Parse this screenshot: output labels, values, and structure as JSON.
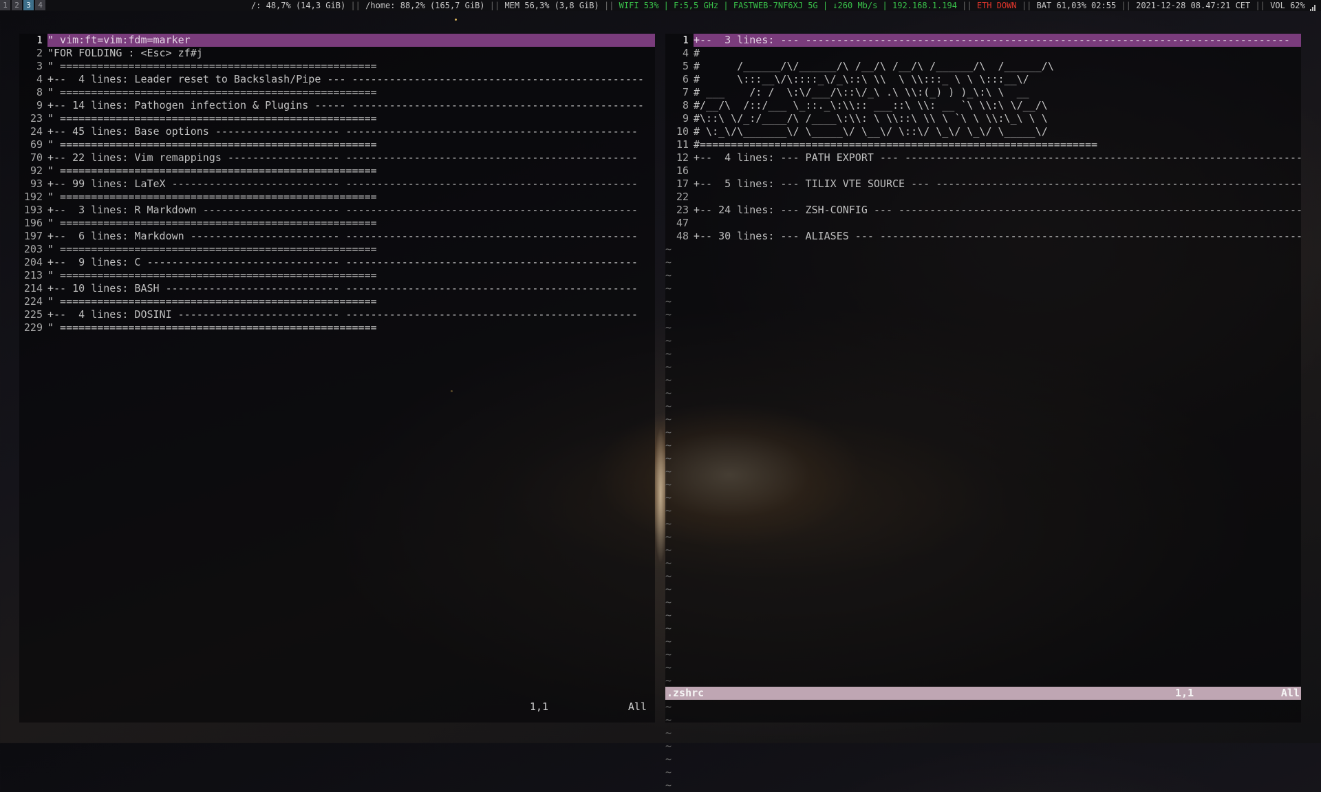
{
  "topbar": {
    "workspaces": [
      "1",
      "2",
      "3",
      "4"
    ],
    "active_workspace": "3",
    "disk_root": "/: 48,7% (14,3 GiB)",
    "disk_home": "/home: 88,2% (165,7 GiB)",
    "mem": "MEM 56,3% (3,8 GiB)",
    "wifi": "WIFI 53% | F:5,5 GHz | FASTWEB-7NF6XJ 5G | ↓260 Mb/s | 192.168.1.194",
    "eth": "ETH DOWN",
    "bat": "BAT 61,03% 02:55",
    "datetime": "2021-12-28 08.47:21 CET",
    "vol": "VOL 62%",
    "separator": "||"
  },
  "left_pane": {
    "lines": [
      {
        "n": "1",
        "t": "\" vim:ft=vim:fdm=marker"
      },
      {
        "n": "2",
        "t": "\"FOR FOLDING : <Esc> zf#j"
      },
      {
        "n": "3",
        "t": "\" ==================================================="
      },
      {
        "n": "4",
        "t": "+--  4 lines: Leader reset to Backslash/Pipe --- -----------------------------------------------"
      },
      {
        "n": "8",
        "t": "\" ==================================================="
      },
      {
        "n": "9",
        "t": "+-- 14 lines: Pathogen infection & Plugins ----- -----------------------------------------------"
      },
      {
        "n": "23",
        "t": "\" ==================================================="
      },
      {
        "n": "24",
        "t": "+-- 45 lines: Base options -------------------- -----------------------------------------------"
      },
      {
        "n": "69",
        "t": "\" ==================================================="
      },
      {
        "n": "70",
        "t": "+-- 22 lines: Vim remappings ------------------ -----------------------------------------------"
      },
      {
        "n": "92",
        "t": "\" ==================================================="
      },
      {
        "n": "93",
        "t": "+-- 99 lines: LaTeX --------------------------- -----------------------------------------------"
      },
      {
        "n": "192",
        "t": "\" ==================================================="
      },
      {
        "n": "193",
        "t": "+--  3 lines: R Markdown ---------------------- -----------------------------------------------"
      },
      {
        "n": "196",
        "t": "\" ==================================================="
      },
      {
        "n": "197",
        "t": "+--  6 lines: Markdown ------------------------ -----------------------------------------------"
      },
      {
        "n": "203",
        "t": "\" ==================================================="
      },
      {
        "n": "204",
        "t": "+--  9 lines: C ------------------------------- -----------------------------------------------"
      },
      {
        "n": "213",
        "t": "\" ==================================================="
      },
      {
        "n": "214",
        "t": "+-- 10 lines: BASH ---------------------------- -----------------------------------------------"
      },
      {
        "n": "224",
        "t": "\" ==================================================="
      },
      {
        "n": "225",
        "t": "+--  4 lines: DOSINI -------------------------- -----------------------------------------------"
      },
      {
        "n": "229",
        "t": "\" ==================================================="
      }
    ],
    "status_pos": "1,1",
    "status_pct": "All"
  },
  "right_pane": {
    "lines": [
      {
        "n": "1",
        "t": "+--  3 lines: --- ------------------------------------------------------------------------------"
      },
      {
        "n": "4",
        "t": "#"
      },
      {
        "n": "5",
        "t": "#      /______/\\/______/\\ /__/\\ /__/\\ /______/\\  /______/\\"
      },
      {
        "n": "6",
        "t": "#      \\:::__\\/\\::::_\\/_\\::\\ \\\\  \\ \\\\:::_ \\ \\ \\:::__\\/"
      },
      {
        "n": "7",
        "t": "# ___    /: /  \\:\\/___/\\::\\/_\\ .\\ \\\\:(_) ) )_\\:\\ \\  __"
      },
      {
        "n": "8",
        "t": "#/__/\\  /::/___ \\_::._\\:\\\\:: ___::\\ \\\\: __ `\\ \\\\:\\ \\/__/\\"
      },
      {
        "n": "9",
        "t": "#\\::\\ \\/_:/____/\\ /____\\:\\\\: \\ \\\\::\\ \\\\ \\ `\\ \\ \\\\:\\_\\ \\ \\"
      },
      {
        "n": "10",
        "t": "# \\:_\\/\\_______\\/ \\_____\\/ \\__\\/ \\::\\/ \\_\\/ \\_\\/ \\_____\\/"
      },
      {
        "n": "11",
        "t": "#================================================================"
      },
      {
        "n": "12",
        "t": "+--  4 lines: --- PATH EXPORT --- ------------------------------------------------------------------"
      },
      {
        "n": "16",
        "t": ""
      },
      {
        "n": "17",
        "t": "+--  5 lines: --- TILIX VTE SOURCE --- -------------------------------------------------------------"
      },
      {
        "n": "22",
        "t": ""
      },
      {
        "n": "23",
        "t": "+-- 24 lines: --- ZSH-CONFIG --- -------------------------------------------------------------------"
      },
      {
        "n": "47",
        "t": ""
      },
      {
        "n": "48",
        "t": "+-- 30 lines: --- ALIASES --- ----------------------------------------------------------------------"
      }
    ],
    "tilde": "~",
    "status_name": ".zshrc",
    "status_pos": "1,1",
    "status_pct": "All"
  }
}
